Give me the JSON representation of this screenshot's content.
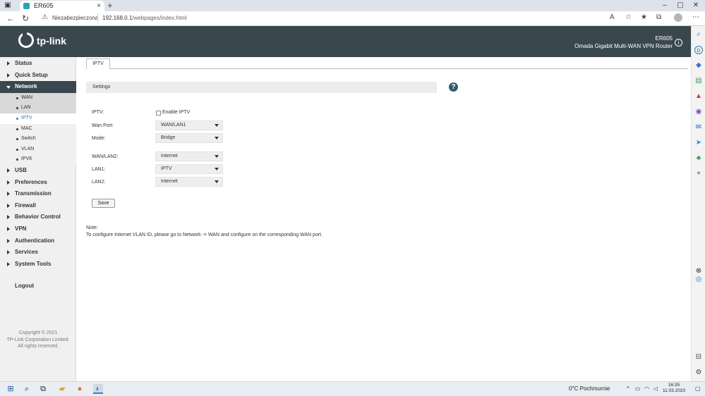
{
  "browser": {
    "tab_title": "ER605",
    "tab_close": "×",
    "new_tab": "+",
    "security_label": "Niezabezpieczona",
    "url_host": "192.168.0.1",
    "url_path": "/webpages/index.html",
    "window_controls": [
      "–",
      "▢",
      "✕"
    ],
    "toolbar_icons": [
      "read-aloud-icon",
      "favorite-add-icon",
      "favorites-icon",
      "collections-icon",
      "profile-icon",
      "more-icon"
    ]
  },
  "header": {
    "logo": "tp-link",
    "model": "ER605",
    "description": "Omada Gigabit Multi-WAN VPN Router",
    "info_symbol": "i"
  },
  "sidebar": {
    "menu_top": [
      {
        "label": "Status"
      },
      {
        "label": "Quick Setup"
      }
    ],
    "network": {
      "label": "Network",
      "items": [
        {
          "label": "WAN",
          "state": "normal"
        },
        {
          "label": "LAN",
          "state": "normal"
        },
        {
          "label": "IPTV",
          "state": "active"
        },
        {
          "label": "MAC",
          "state": "lite"
        },
        {
          "label": "Switch",
          "state": "lite"
        },
        {
          "label": "VLAN",
          "state": "lite"
        },
        {
          "label": "IPV6",
          "state": "lite"
        }
      ]
    },
    "menu_bottom": [
      {
        "label": "USB"
      },
      {
        "label": "Preferences"
      },
      {
        "label": "Transmission"
      },
      {
        "label": "Firewall"
      },
      {
        "label": "Behavior Control"
      },
      {
        "label": "VPN"
      },
      {
        "label": "Authentication"
      },
      {
        "label": "Services"
      },
      {
        "label": "System Tools"
      }
    ],
    "logout": "Logout",
    "copyright": [
      "Copyright © 2021",
      "TP-Link Corporation Limited.",
      "All rights reserved."
    ]
  },
  "content": {
    "tab": "IPTV",
    "section": "Settings",
    "help_symbol": "?",
    "fields": {
      "iptv_label": "IPTV:",
      "iptv_checkbox_label": "Enable IPTV",
      "iptv_enabled": false,
      "wan_port_label": "Wan Port:",
      "wan_port_value": "WAN/LAN1",
      "mode_label": "Mode:",
      "mode_value": "Bridge",
      "wanlan2_label": "WAN/LAN2:",
      "wanlan2_value": "Internet",
      "lan1_label": "LAN1:",
      "lan1_value": "IPTV",
      "lan2_label": "LAN2:",
      "lan2_value": "Internet"
    },
    "save_label": "Save",
    "note_heading": "Note:",
    "note_text": "To configure Internet VLAN ID, please go to Network -> WAN and configure on the corresponding WAN port."
  },
  "taskbar": {
    "weather": "0°C  Pochmurnie",
    "time": "16:35",
    "date": "11.03.2023"
  }
}
